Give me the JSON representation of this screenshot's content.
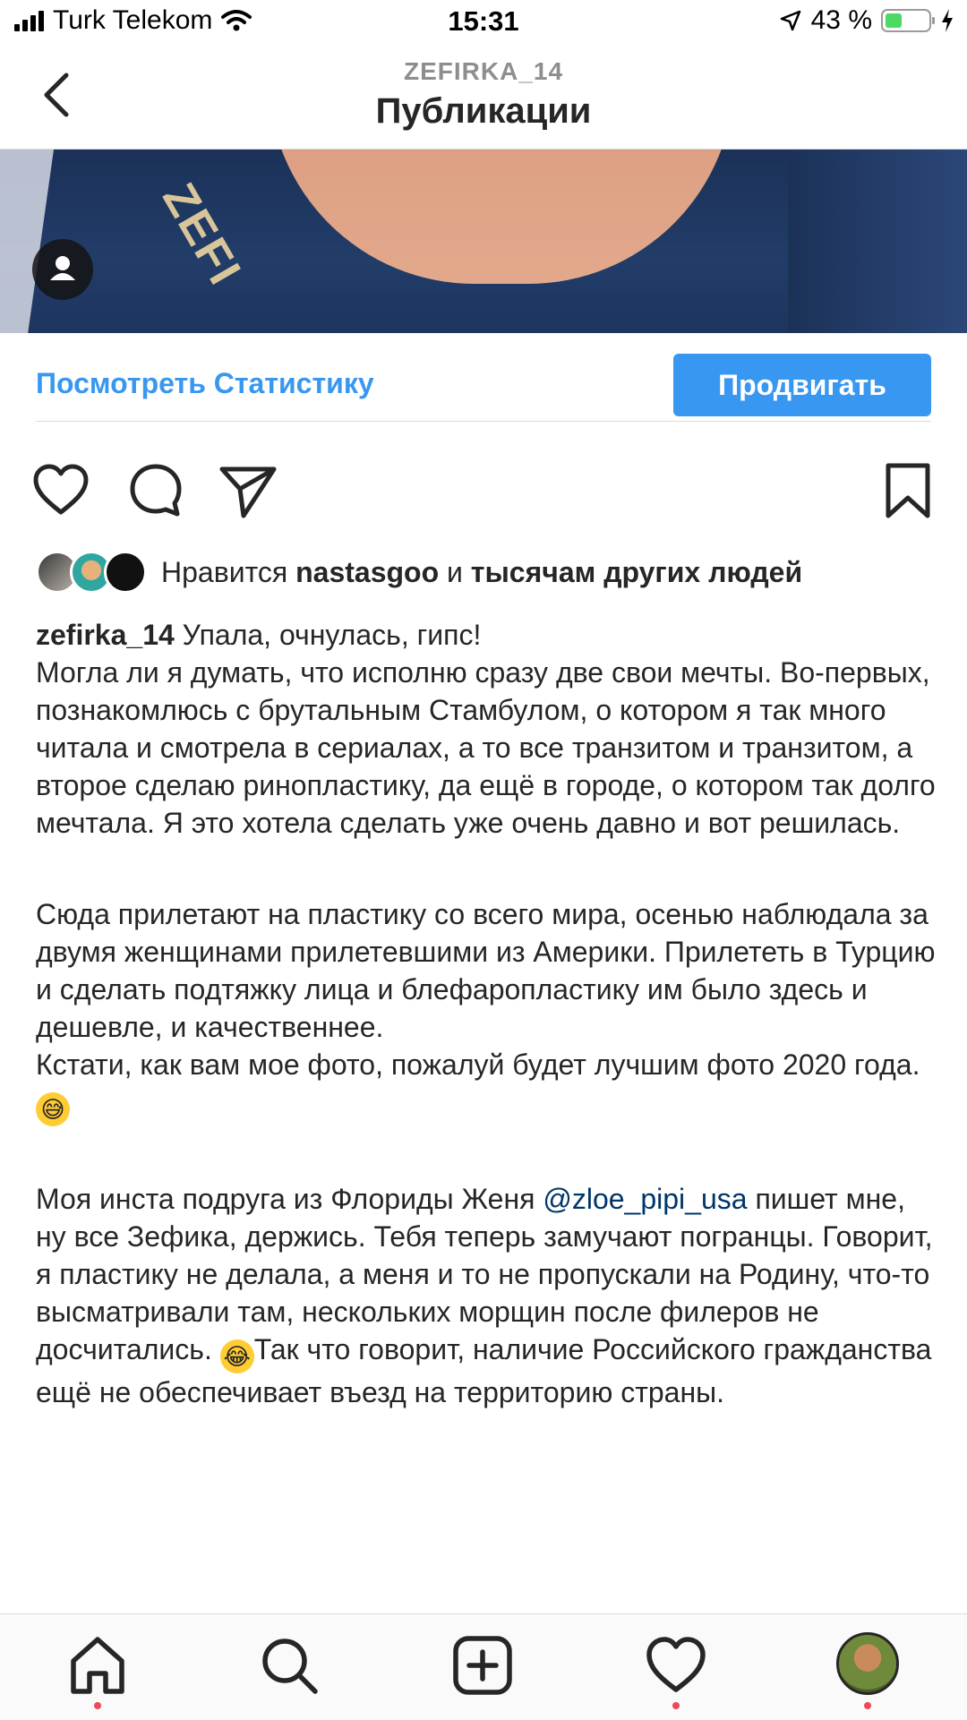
{
  "status_bar": {
    "carrier": "Turk Telekom",
    "time": "15:31",
    "battery_percent": "43 %",
    "battery_level": 0.43
  },
  "header": {
    "username": "ZEFIRKA_14",
    "title": "Публикации",
    "back_icon": "chevron-left-icon"
  },
  "post_actions": {
    "insights_label": "Посмотреть Статистику",
    "promote_label": "Продвигать"
  },
  "action_icons": [
    "heart-icon",
    "comment-icon",
    "share-icon",
    "bookmark-icon"
  ],
  "likes": {
    "prefix": "Нравится",
    "user": "nastasgoo",
    "conjunction": "и",
    "others": "тысячам других людей"
  },
  "caption": {
    "author": "zefirka_14",
    "first_line": "Упала, очнулась, гипс!",
    "para1": "Могла ли я думать, что исполню сразу две свои мечты. Во-первых, познакомлюсь с брутальным Стамбулом, о котором я так много читала и смотрела в сериалах, а то все транзитом и транзитом, а второе сделаю ринопластику, да ещё в городе, о котором так долго мечтала. Я это хотела сделать уже очень давно и вот решилась.",
    "para2": "Сюда прилетают на пластику со всего мира,  осенью наблюдала за двумя женщинами прилетевшими из Америки. Прилететь в Турцию и сделать подтяжку лица и блефаропластику им было здесь и дешевле, и качественнее.",
    "para3": "Кстати, как вам мое фото, пожалуй будет лучшим фото 2020 года.",
    "para4_start": "Моя инста подруга из Флориды Женя",
    "mention": "@zloe_pipi_usa",
    "para4_mid": "пишет мне, ну все Зефика, держись. Тебя теперь замучают погранцы. Говорит, я пластику не делала, а меня и то не пропускали на Родину, что-то высматривали там, нескольких морщин после филеров не досчитались.",
    "para4_end": "Так что говорит, наличие Российского гражданства ещё не обеспечивает въезд на территорию страны."
  },
  "tab_bar": [
    "home-icon",
    "search-icon",
    "add-post-icon",
    "activity-icon",
    "profile-avatar"
  ],
  "colors": {
    "link_blue": "#3897f0",
    "mention": "#003569",
    "text": "#262626",
    "notification_dot": "#ed4956"
  }
}
